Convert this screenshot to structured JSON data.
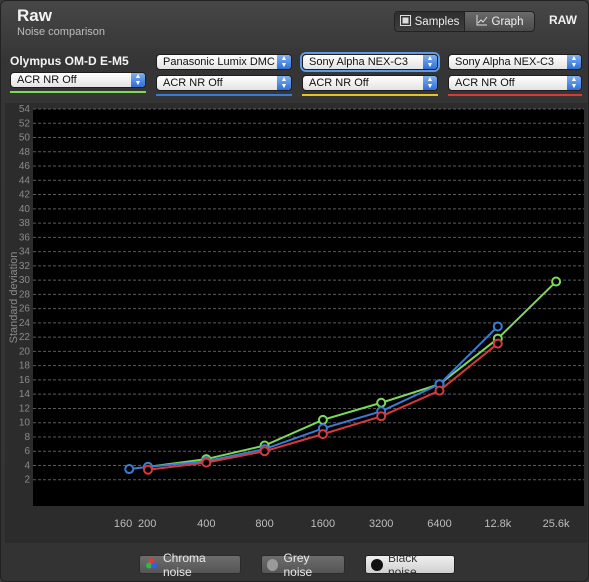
{
  "header": {
    "title": "Raw",
    "subtitle": "Noise comparison",
    "badge": "RAW"
  },
  "view_toggle": {
    "samples_label": "Samples",
    "graph_label": "Graph",
    "active": "Samples",
    "samples_icon": "grid-icon",
    "graph_icon": "line-graph-icon"
  },
  "cameras": [
    {
      "name": "Olympus OM-D E-M5",
      "setting": "ACR NR Off",
      "color": "#7ed957"
    },
    {
      "name": "Panasonic Lumix DMC",
      "setting": "ACR NR Off",
      "color": "#3a7bd5"
    },
    {
      "name": "Sony Alpha NEX-C3",
      "setting": "ACR NR Off",
      "color": "#e2c32b"
    },
    {
      "name": "Sony Alpha NEX-C3",
      "setting": "ACR NR Off",
      "color": "#d63a3a"
    }
  ],
  "legend": {
    "chroma": "Chroma noise",
    "grey": "Grey noise",
    "black": "Black noise",
    "active": "Black noise"
  },
  "chart_data": {
    "type": "line",
    "ylabel": "Standard deviation",
    "xlabel": "",
    "ylim": [
      0,
      54
    ],
    "y_ticks": [
      2,
      4,
      6,
      8,
      10,
      12,
      14,
      16,
      18,
      20,
      22,
      24,
      26,
      28,
      30,
      32,
      34,
      36,
      38,
      40,
      42,
      44,
      46,
      48,
      50,
      52,
      54
    ],
    "x_ticks": [
      "160",
      "200",
      "400",
      "800",
      "1600",
      "3200",
      "6400",
      "12.8k",
      "25.6k"
    ],
    "grid": true,
    "series": [
      {
        "camera": "Olympus OM-D E-M5",
        "color": "#7ed957",
        "points": [
          [
            "200",
            3.8
          ],
          [
            "400",
            4.9
          ],
          [
            "800",
            6.8
          ],
          [
            "1600",
            10.4
          ],
          [
            "3200",
            12.8
          ],
          [
            "6400",
            15.4
          ],
          [
            "12.8k",
            21.8
          ],
          [
            "25.6k",
            29.8
          ]
        ]
      },
      {
        "camera": "Panasonic Lumix DMC",
        "color": "#3a7bd5",
        "points": [
          [
            "160",
            3.5
          ],
          [
            "200",
            3.8
          ],
          [
            "400",
            4.6
          ],
          [
            "800",
            6.3
          ],
          [
            "1600",
            9.2
          ],
          [
            "3200",
            11.6
          ],
          [
            "6400",
            15.4
          ],
          [
            "12.8k",
            23.5
          ]
        ]
      },
      {
        "camera": "Sony Alpha NEX-C3 (red)",
        "color": "#d63a3a",
        "points": [
          [
            "200",
            3.4
          ],
          [
            "400",
            4.4
          ],
          [
            "800",
            6.0
          ],
          [
            "1600",
            8.4
          ],
          [
            "3200",
            10.9
          ],
          [
            "6400",
            14.5
          ],
          [
            "12.8k",
            21.1
          ]
        ]
      }
    ]
  }
}
